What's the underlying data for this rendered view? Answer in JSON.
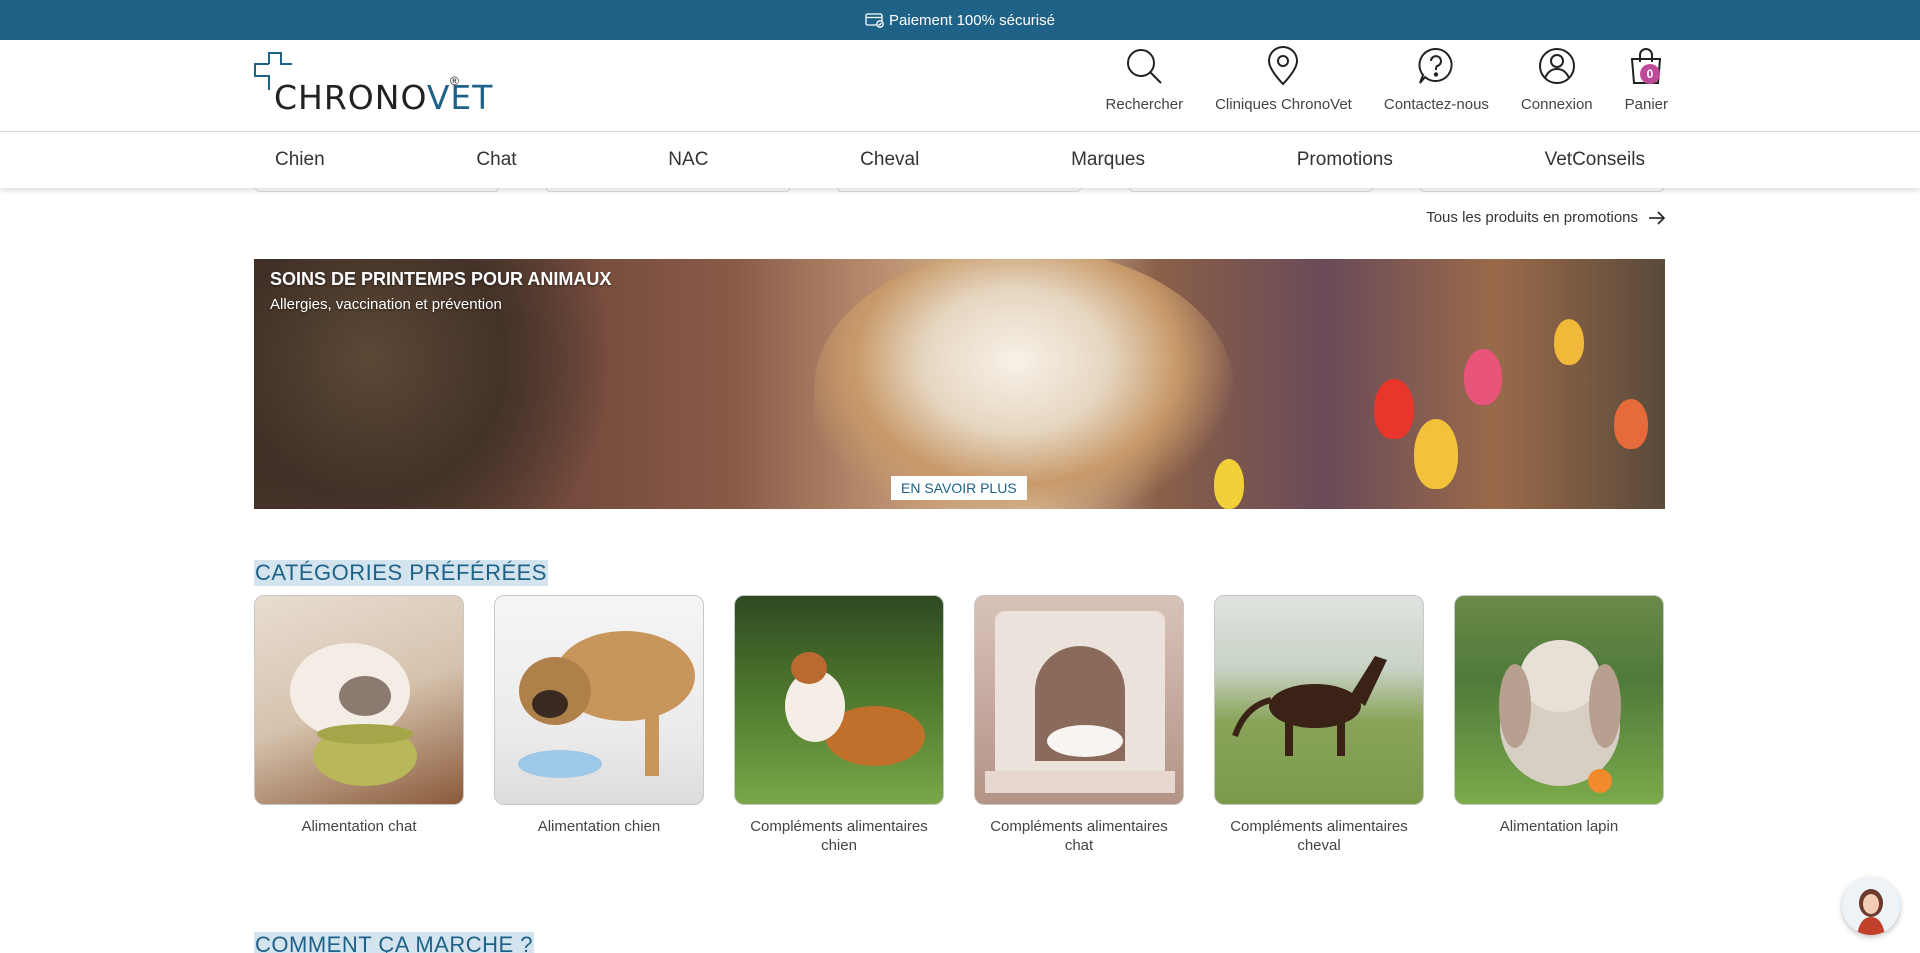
{
  "topbar": {
    "text": "Paiement 100% sécurisé",
    "icon": "secure-card-icon"
  },
  "header": {
    "logo_text_chrono": "CHRONO",
    "logo_text_vet": "VET",
    "logo_reg": "®",
    "actions": [
      {
        "label": "Rechercher",
        "icon": "search-icon"
      },
      {
        "label": "Cliniques ChronoVet",
        "icon": "location-pin-icon"
      },
      {
        "label": "Contactez-nous",
        "icon": "help-chat-icon"
      },
      {
        "label": "Connexion",
        "icon": "user-icon"
      },
      {
        "label": "Panier",
        "icon": "shopping-bag-icon",
        "badge": "0"
      }
    ]
  },
  "nav": {
    "items": [
      "Chien",
      "Chat",
      "NAC",
      "Cheval",
      "Marques",
      "Promotions",
      "VetConseils"
    ]
  },
  "promotions": {
    "link_label": "Tous les produits en promotions"
  },
  "banner": {
    "title": "SOINS DE PRINTEMPS POUR ANIMAUX",
    "subtitle": "Allergies, vaccination et prévention",
    "cta": "EN SAVOIR PLUS"
  },
  "categories": {
    "title": "CATÉGORIES PRÉFÉRÉES",
    "items": [
      {
        "label": "Alimentation chat"
      },
      {
        "label": "Alimentation chien"
      },
      {
        "label": "Compléments alimentaires chien"
      },
      {
        "label": "Compléments alimentaires chat"
      },
      {
        "label": "Compléments alimentaires cheval"
      },
      {
        "label": "Alimentation lapin"
      }
    ]
  },
  "how_it_works": {
    "title": "COMMENT ÇA MARCHE ?"
  },
  "colors": {
    "brand": "#1e6288",
    "badge": "#c04a9a"
  }
}
